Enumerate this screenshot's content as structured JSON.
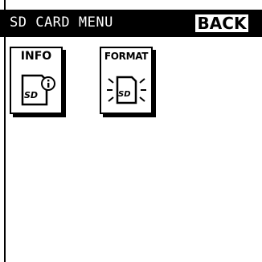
{
  "header": {
    "title": "SD CARD MENU",
    "back_label": "BACK"
  },
  "menu": {
    "items": [
      {
        "label": "INFO",
        "icon": "sd-card-info-icon",
        "card_text": "SD"
      },
      {
        "label": "FORMAT",
        "icon": "sd-card-format-icon",
        "card_text": "SD"
      }
    ]
  },
  "colors": {
    "foreground": "#000000",
    "background": "#ffffff"
  }
}
